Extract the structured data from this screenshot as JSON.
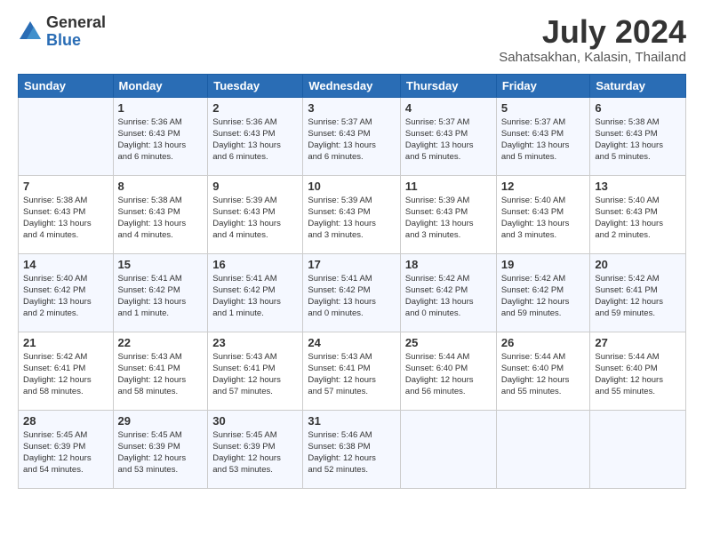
{
  "header": {
    "logo": {
      "general": "General",
      "blue": "Blue"
    },
    "title": "July 2024",
    "location": "Sahatsakhan, Kalasin, Thailand"
  },
  "calendar": {
    "headers": [
      "Sunday",
      "Monday",
      "Tuesday",
      "Wednesday",
      "Thursday",
      "Friday",
      "Saturday"
    ],
    "weeks": [
      [
        {
          "day": "",
          "info": ""
        },
        {
          "day": "1",
          "info": "Sunrise: 5:36 AM\nSunset: 6:43 PM\nDaylight: 13 hours\nand 6 minutes."
        },
        {
          "day": "2",
          "info": "Sunrise: 5:36 AM\nSunset: 6:43 PM\nDaylight: 13 hours\nand 6 minutes."
        },
        {
          "day": "3",
          "info": "Sunrise: 5:37 AM\nSunset: 6:43 PM\nDaylight: 13 hours\nand 6 minutes."
        },
        {
          "day": "4",
          "info": "Sunrise: 5:37 AM\nSunset: 6:43 PM\nDaylight: 13 hours\nand 5 minutes."
        },
        {
          "day": "5",
          "info": "Sunrise: 5:37 AM\nSunset: 6:43 PM\nDaylight: 13 hours\nand 5 minutes."
        },
        {
          "day": "6",
          "info": "Sunrise: 5:38 AM\nSunset: 6:43 PM\nDaylight: 13 hours\nand 5 minutes."
        }
      ],
      [
        {
          "day": "7",
          "info": "Sunrise: 5:38 AM\nSunset: 6:43 PM\nDaylight: 13 hours\nand 4 minutes."
        },
        {
          "day": "8",
          "info": "Sunrise: 5:38 AM\nSunset: 6:43 PM\nDaylight: 13 hours\nand 4 minutes."
        },
        {
          "day": "9",
          "info": "Sunrise: 5:39 AM\nSunset: 6:43 PM\nDaylight: 13 hours\nand 4 minutes."
        },
        {
          "day": "10",
          "info": "Sunrise: 5:39 AM\nSunset: 6:43 PM\nDaylight: 13 hours\nand 3 minutes."
        },
        {
          "day": "11",
          "info": "Sunrise: 5:39 AM\nSunset: 6:43 PM\nDaylight: 13 hours\nand 3 minutes."
        },
        {
          "day": "12",
          "info": "Sunrise: 5:40 AM\nSunset: 6:43 PM\nDaylight: 13 hours\nand 3 minutes."
        },
        {
          "day": "13",
          "info": "Sunrise: 5:40 AM\nSunset: 6:43 PM\nDaylight: 13 hours\nand 2 minutes."
        }
      ],
      [
        {
          "day": "14",
          "info": "Sunrise: 5:40 AM\nSunset: 6:42 PM\nDaylight: 13 hours\nand 2 minutes."
        },
        {
          "day": "15",
          "info": "Sunrise: 5:41 AM\nSunset: 6:42 PM\nDaylight: 13 hours\nand 1 minute."
        },
        {
          "day": "16",
          "info": "Sunrise: 5:41 AM\nSunset: 6:42 PM\nDaylight: 13 hours\nand 1 minute."
        },
        {
          "day": "17",
          "info": "Sunrise: 5:41 AM\nSunset: 6:42 PM\nDaylight: 13 hours\nand 0 minutes."
        },
        {
          "day": "18",
          "info": "Sunrise: 5:42 AM\nSunset: 6:42 PM\nDaylight: 13 hours\nand 0 minutes."
        },
        {
          "day": "19",
          "info": "Sunrise: 5:42 AM\nSunset: 6:42 PM\nDaylight: 12 hours\nand 59 minutes."
        },
        {
          "day": "20",
          "info": "Sunrise: 5:42 AM\nSunset: 6:41 PM\nDaylight: 12 hours\nand 59 minutes."
        }
      ],
      [
        {
          "day": "21",
          "info": "Sunrise: 5:42 AM\nSunset: 6:41 PM\nDaylight: 12 hours\nand 58 minutes."
        },
        {
          "day": "22",
          "info": "Sunrise: 5:43 AM\nSunset: 6:41 PM\nDaylight: 12 hours\nand 58 minutes."
        },
        {
          "day": "23",
          "info": "Sunrise: 5:43 AM\nSunset: 6:41 PM\nDaylight: 12 hours\nand 57 minutes."
        },
        {
          "day": "24",
          "info": "Sunrise: 5:43 AM\nSunset: 6:41 PM\nDaylight: 12 hours\nand 57 minutes."
        },
        {
          "day": "25",
          "info": "Sunrise: 5:44 AM\nSunset: 6:40 PM\nDaylight: 12 hours\nand 56 minutes."
        },
        {
          "day": "26",
          "info": "Sunrise: 5:44 AM\nSunset: 6:40 PM\nDaylight: 12 hours\nand 55 minutes."
        },
        {
          "day": "27",
          "info": "Sunrise: 5:44 AM\nSunset: 6:40 PM\nDaylight: 12 hours\nand 55 minutes."
        }
      ],
      [
        {
          "day": "28",
          "info": "Sunrise: 5:45 AM\nSunset: 6:39 PM\nDaylight: 12 hours\nand 54 minutes."
        },
        {
          "day": "29",
          "info": "Sunrise: 5:45 AM\nSunset: 6:39 PM\nDaylight: 12 hours\nand 53 minutes."
        },
        {
          "day": "30",
          "info": "Sunrise: 5:45 AM\nSunset: 6:39 PM\nDaylight: 12 hours\nand 53 minutes."
        },
        {
          "day": "31",
          "info": "Sunrise: 5:46 AM\nSunset: 6:38 PM\nDaylight: 12 hours\nand 52 minutes."
        },
        {
          "day": "",
          "info": ""
        },
        {
          "day": "",
          "info": ""
        },
        {
          "day": "",
          "info": ""
        }
      ]
    ]
  }
}
